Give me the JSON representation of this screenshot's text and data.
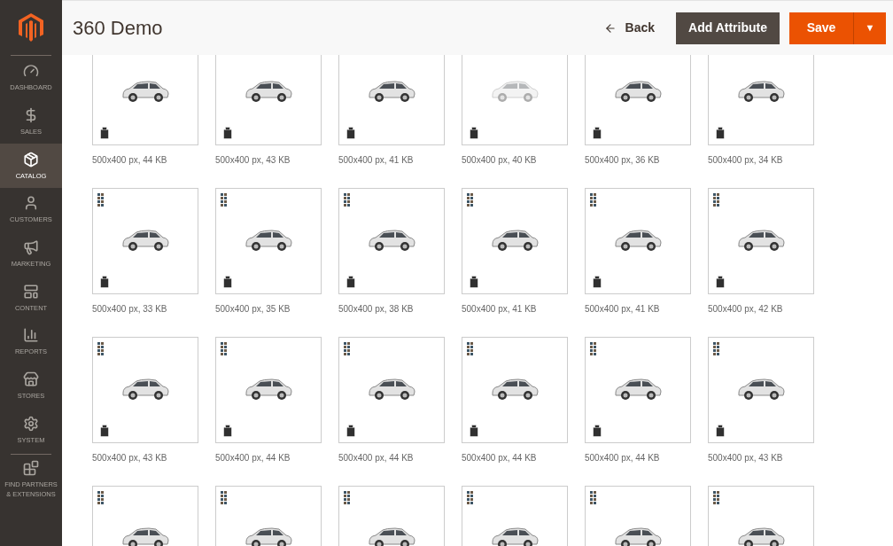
{
  "sidebar": {
    "items": [
      {
        "label": "DASHBOARD",
        "selected": false
      },
      {
        "label": "SALES",
        "selected": false
      },
      {
        "label": "CATALOG",
        "selected": true
      },
      {
        "label": "CUSTOMERS",
        "selected": false
      },
      {
        "label": "MARKETING",
        "selected": false
      },
      {
        "label": "CONTENT",
        "selected": false
      },
      {
        "label": "REPORTS",
        "selected": false
      },
      {
        "label": "STORES",
        "selected": false
      },
      {
        "label": "SYSTEM",
        "selected": false
      },
      {
        "label": "FIND PARTNERS & EXTENSIONS",
        "selected": false
      }
    ]
  },
  "header": {
    "title": "360 Demo",
    "back": "Back",
    "add_attribute": "Add Attribute",
    "save": "Save",
    "save_menu": "▼"
  },
  "gallery": {
    "rows": [
      {
        "handles": false,
        "trash": true,
        "tiles": [
          {
            "caption": "500x400 px, 44 KB",
            "faded": false
          },
          {
            "caption": "500x400 px, 43 KB",
            "faded": false
          },
          {
            "caption": "500x400 px, 41 KB",
            "faded": false
          },
          {
            "caption": "500x400 px, 40 KB",
            "faded": true
          },
          {
            "caption": "500x400 px, 36 KB",
            "faded": false
          },
          {
            "caption": "500x400 px, 34 KB",
            "faded": false
          }
        ]
      },
      {
        "handles": true,
        "trash": true,
        "tiles": [
          {
            "caption": "500x400 px, 33 KB",
            "faded": false
          },
          {
            "caption": "500x400 px, 35 KB",
            "faded": false
          },
          {
            "caption": "500x400 px, 38 KB",
            "faded": false
          },
          {
            "caption": "500x400 px, 41 KB",
            "faded": false
          },
          {
            "caption": "500x400 px, 41 KB",
            "faded": false
          },
          {
            "caption": "500x400 px, 42 KB",
            "faded": false
          }
        ]
      },
      {
        "handles": true,
        "trash": true,
        "tiles": [
          {
            "caption": "500x400 px, 43 KB",
            "faded": false
          },
          {
            "caption": "500x400 px, 44 KB",
            "faded": false
          },
          {
            "caption": "500x400 px, 44 KB",
            "faded": false
          },
          {
            "caption": "500x400 px, 44 KB",
            "faded": false
          },
          {
            "caption": "500x400 px, 44 KB",
            "faded": false
          },
          {
            "caption": "500x400 px, 43 KB",
            "faded": false
          }
        ]
      },
      {
        "handles": true,
        "trash": false,
        "tiles": [
          {
            "faded": false
          },
          {
            "faded": false
          },
          {
            "faded": false
          },
          {
            "faded": false
          },
          {
            "faded": false
          },
          {
            "faded": false
          }
        ]
      }
    ]
  }
}
